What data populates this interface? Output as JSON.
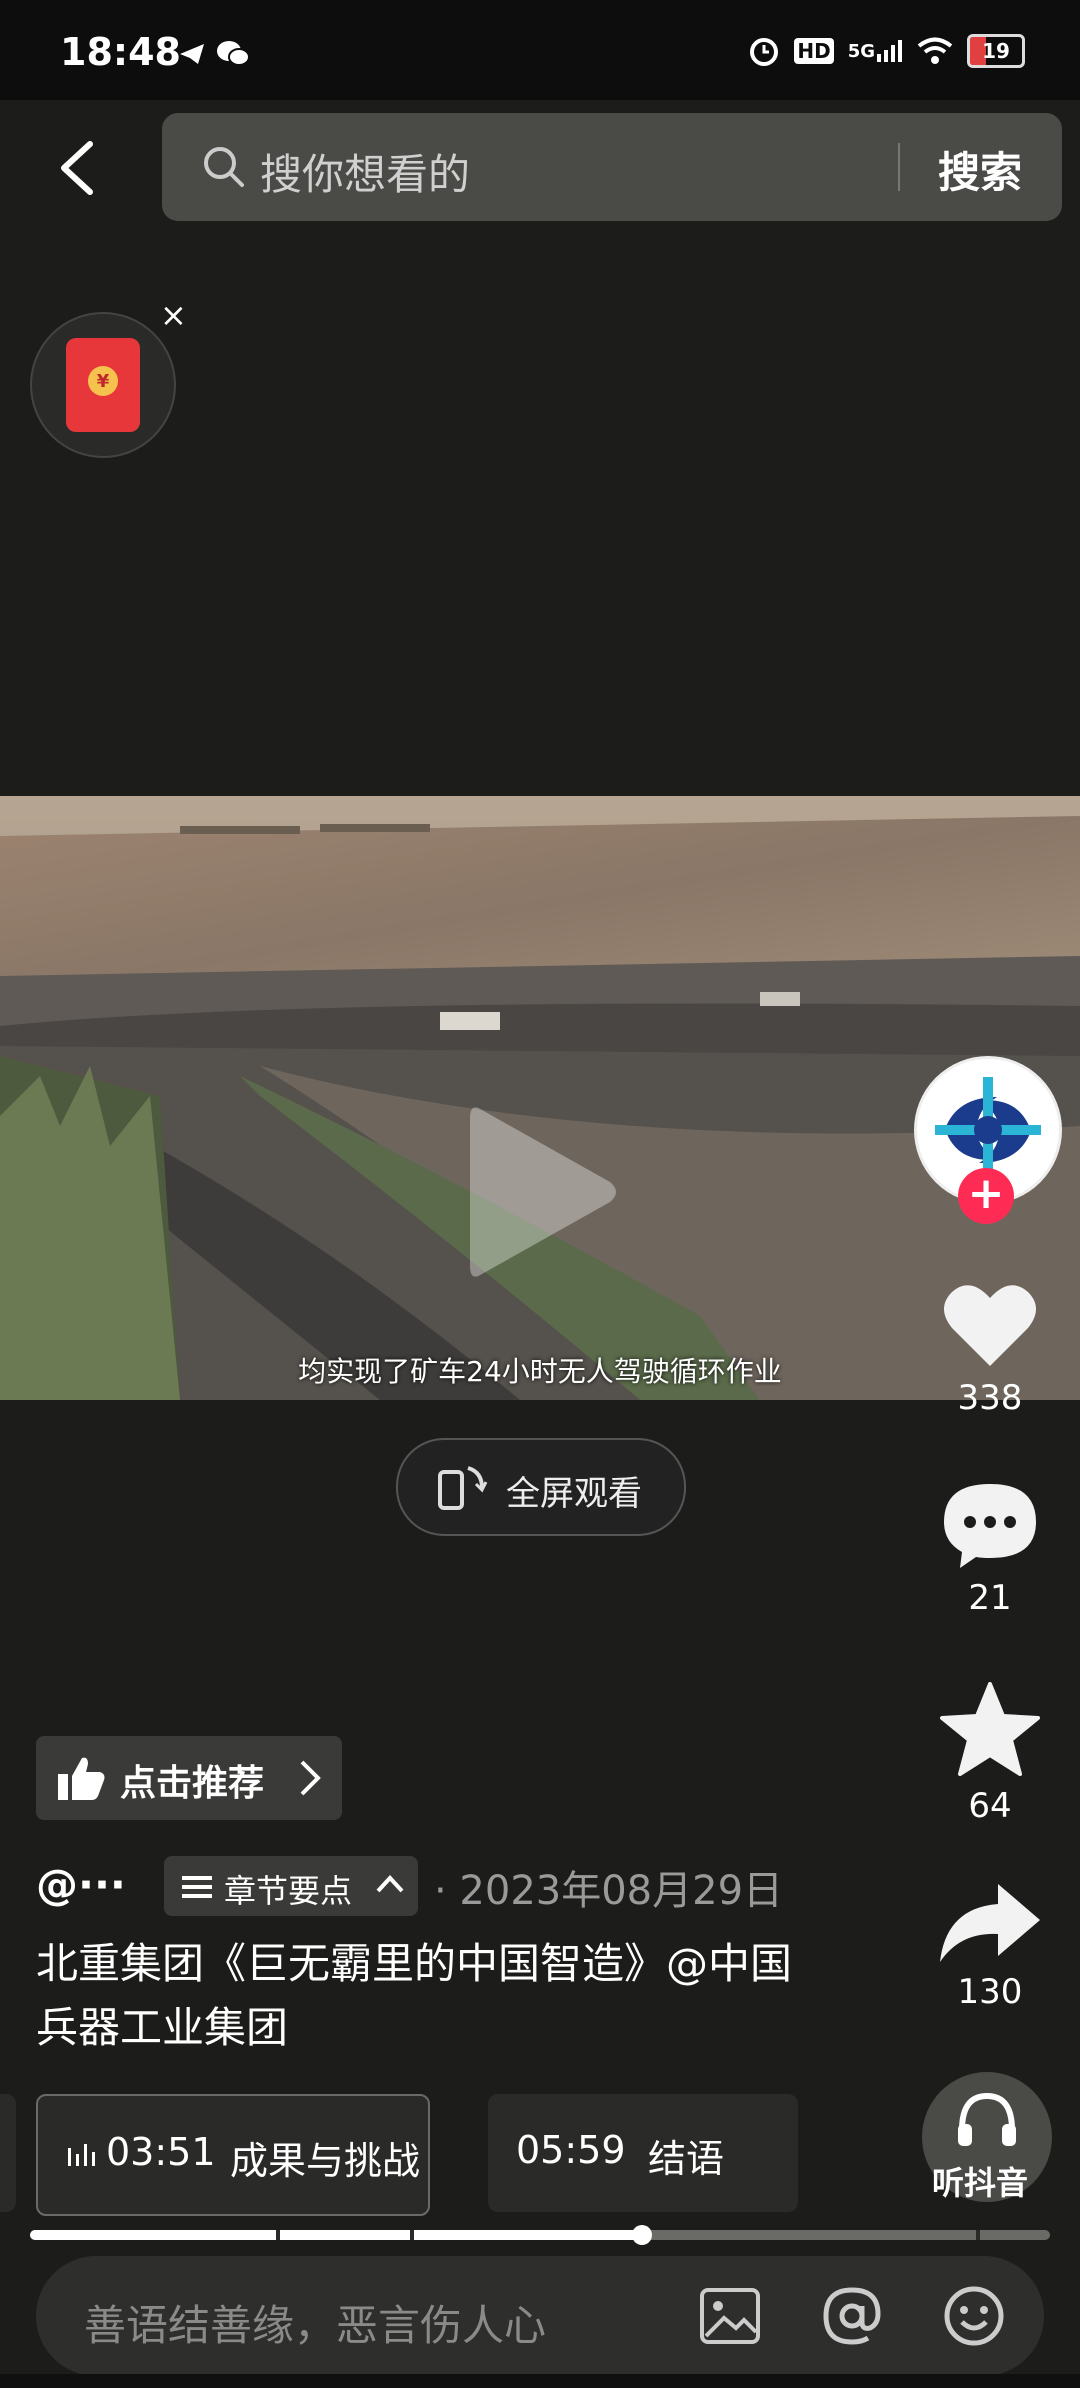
{
  "status_bar": {
    "time": "18:48",
    "network": "5G",
    "hd": "HD",
    "battery": "19"
  },
  "search": {
    "placeholder": "搜你想看的",
    "button": "搜索"
  },
  "red_packet": {
    "close": "×",
    "coin": "¥"
  },
  "video": {
    "subtitle": "均实现了矿车24小时无人驾驶循环作业",
    "fullscreen_label": "全屏观看"
  },
  "actions": {
    "likes": "338",
    "comments": "21",
    "favorites": "64",
    "shares": "130",
    "follow": "+"
  },
  "post": {
    "recommend_label": "点击推荐",
    "author": "@···",
    "chapter_toggle": "章节要点",
    "date": "· 2023年08月29日",
    "title": "北重集团《巨无霸里的中国智造》@中国兵器工业集团"
  },
  "chapters": [
    {
      "time": "03:51",
      "name": "成果与挑战",
      "active": true
    },
    {
      "time": "05:59",
      "name": "结语",
      "active": false
    }
  ],
  "listen": {
    "label": "听抖音"
  },
  "playback": {
    "progress": 0.6
  },
  "comment": {
    "placeholder": "善语结善缘，恶言伤人心"
  },
  "colors": {
    "accent_red": "#fe2c55",
    "background": "#1c1c1a"
  }
}
